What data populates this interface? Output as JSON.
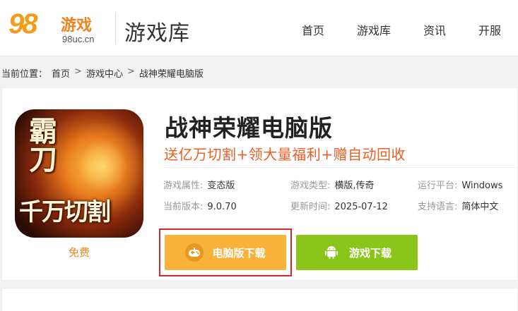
{
  "header": {
    "logo_number": "98",
    "logo_text": "游戏",
    "logo_domain": "98uc.cn",
    "site_title": "游戏库",
    "nav": [
      "首页",
      "游戏库",
      "资讯",
      "开服"
    ]
  },
  "breadcrumb": {
    "prefix": "当前位置：",
    "items": [
      "首页",
      "游戏中心",
      "战神荣耀电脑版"
    ],
    "separator": ">"
  },
  "game": {
    "icon_text_top": "霸刀",
    "icon_text_bottom": "千万切割",
    "price_label": "免费",
    "title": "战神荣耀电脑版",
    "slogan": "送亿万切割+领大量福利+赠自动回收",
    "info": [
      {
        "label": "游戏属性:",
        "value": "变态版"
      },
      {
        "label": "游戏类型:",
        "value": "横版,传奇"
      },
      {
        "label": "运行平台:",
        "value": "Windows"
      },
      {
        "label": "当前版本:",
        "value": "9.0.70"
      },
      {
        "label": "更新时间:",
        "value": "2025-07-12"
      },
      {
        "label": "支持语言:",
        "value": "简体中文"
      }
    ],
    "buttons": {
      "pc_download": "电脑版下载",
      "game_download": "游戏下载",
      "pc_icon": "gamepad-icon",
      "game_icon": "android-icon"
    }
  },
  "colors": {
    "accent_orange": "#f0831e",
    "slogan_red": "#ef5d22",
    "pc_button": "#f8b23a",
    "game_button": "#8bc519",
    "highlight_border": "#d9262a"
  }
}
